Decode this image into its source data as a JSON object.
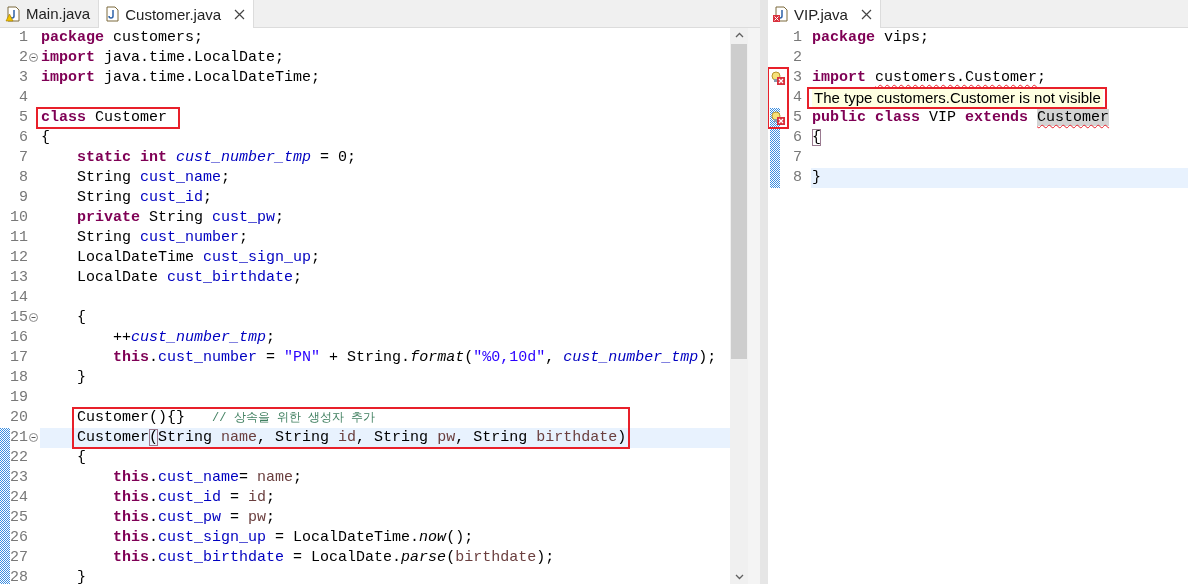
{
  "editors": [
    {
      "tabs": [
        {
          "label": "Main.java",
          "selected": false,
          "kind": "java_warning"
        },
        {
          "label": "Customer.java",
          "selected": true,
          "kind": "java"
        }
      ],
      "lines": [
        {
          "number": "1",
          "kind": "plain",
          "tokens": [
            {
              "kind": "keyword",
              "text": "package"
            },
            {
              "kind": "plain",
              "text": " customers;"
            }
          ]
        },
        {
          "number": "2",
          "kind": "plain",
          "foldable": true,
          "tokens": [
            {
              "kind": "keyword",
              "text": "import"
            },
            {
              "kind": "plain",
              "text": " java.time.LocalDate;"
            }
          ]
        },
        {
          "number": "3",
          "kind": "plain",
          "tokens": [
            {
              "kind": "keyword",
              "text": "import"
            },
            {
              "kind": "plain",
              "text": " java.time.LocalDateTime;"
            }
          ]
        },
        {
          "number": "4",
          "kind": "plain"
        },
        {
          "number": "5",
          "kind": "plain",
          "boxed": true,
          "tokens": [
            {
              "kind": "keyword",
              "text": "class"
            },
            {
              "kind": "plain",
              "text": " Customer "
            }
          ]
        },
        {
          "number": "6",
          "kind": "plain",
          "tokens": [
            {
              "kind": "plain",
              "text": "{"
            }
          ]
        },
        {
          "number": "7",
          "kind": "plain",
          "tokens": [
            {
              "kind": "keyword",
              "text": "    static "
            },
            {
              "kind": "keyword",
              "text": "int "
            },
            {
              "kind": "static_field",
              "text": "cust_number_tmp"
            },
            {
              "kind": "plain",
              "text": " = 0;"
            }
          ]
        },
        {
          "number": "8",
          "kind": "plain",
          "tokens": [
            {
              "kind": "plain",
              "text": "    String "
            },
            {
              "kind": "field",
              "text": "cust_name"
            },
            {
              "kind": "plain",
              "text": ";"
            }
          ]
        },
        {
          "number": "9",
          "kind": "plain",
          "tokens": [
            {
              "kind": "plain",
              "text": "    String "
            },
            {
              "kind": "field",
              "text": "cust_id"
            },
            {
              "kind": "plain",
              "text": ";"
            }
          ]
        },
        {
          "number": "10",
          "kind": "plain",
          "tokens": [
            {
              "kind": "keyword",
              "text": "    private"
            },
            {
              "kind": "plain",
              "text": " String "
            },
            {
              "kind": "field",
              "text": "cust_pw"
            },
            {
              "kind": "plain",
              "text": ";"
            }
          ]
        },
        {
          "number": "11",
          "kind": "plain",
          "tokens": [
            {
              "kind": "plain",
              "text": "    String "
            },
            {
              "kind": "field",
              "text": "cust_number"
            },
            {
              "kind": "plain",
              "text": ";"
            }
          ]
        },
        {
          "number": "12",
          "kind": "plain",
          "tokens": [
            {
              "kind": "plain",
              "text": "    LocalDateTime "
            },
            {
              "kind": "field",
              "text": "cust_sign_up"
            },
            {
              "kind": "plain",
              "text": ";"
            }
          ]
        },
        {
          "number": "13",
          "kind": "plain",
          "tokens": [
            {
              "kind": "plain",
              "text": "    LocalDate "
            },
            {
              "kind": "field",
              "text": "cust_birthdate"
            },
            {
              "kind": "plain",
              "text": ";"
            }
          ]
        },
        {
          "number": "14",
          "kind": "plain"
        },
        {
          "number": "15",
          "kind": "plain",
          "foldable": true,
          "tokens": [
            {
              "kind": "plain",
              "text": "    {"
            }
          ]
        },
        {
          "number": "16",
          "kind": "plain",
          "tokens": [
            {
              "kind": "plain",
              "text": "        ++"
            },
            {
              "kind": "static_field",
              "text": "cust_number_tmp"
            },
            {
              "kind": "plain",
              "text": ";"
            }
          ]
        },
        {
          "number": "17",
          "kind": "plain",
          "tokens": [
            {
              "kind": "keyword",
              "text": "        this"
            },
            {
              "kind": "plain",
              "text": "."
            },
            {
              "kind": "field",
              "text": "cust_number"
            },
            {
              "kind": "plain",
              "text": " = "
            },
            {
              "kind": "string",
              "text": "\"PN\""
            },
            {
              "kind": "plain",
              "text": " + String."
            },
            {
              "kind": "static_method",
              "text": "format"
            },
            {
              "kind": "plain",
              "text": "("
            },
            {
              "kind": "string",
              "text": "\"%0,10d\""
            },
            {
              "kind": "plain",
              "text": ", "
            },
            {
              "kind": "static_field",
              "text": "cust_number_tmp"
            },
            {
              "kind": "plain",
              "text": ");"
            }
          ]
        },
        {
          "number": "18",
          "kind": "plain",
          "tokens": [
            {
              "kind": "plain",
              "text": "    }"
            }
          ]
        },
        {
          "number": "19",
          "kind": "plain"
        },
        {
          "number": "20",
          "kind": "plain",
          "boxed": true,
          "tokens": [
            {
              "kind": "plain",
              "text": "    Customer(){}   "
            },
            {
              "kind": "comment",
              "text": "// 상속을 위한 생성자 추가"
            }
          ]
        },
        {
          "number": "21",
          "kind": "plain",
          "foldable": true,
          "changed": true,
          "highlighted": true,
          "boxed": true,
          "tokens": [
            {
              "kind": "plain",
              "text": "    Customer"
            },
            {
              "kind": "bracket_match",
              "text": "("
            },
            {
              "kind": "plain",
              "text": "String "
            },
            {
              "kind": "param",
              "text": "name"
            },
            {
              "kind": "plain",
              "text": ", String "
            },
            {
              "kind": "param",
              "text": "id"
            },
            {
              "kind": "plain",
              "text": ", String "
            },
            {
              "kind": "param",
              "text": "pw"
            },
            {
              "kind": "plain",
              "text": ", String "
            },
            {
              "kind": "param",
              "text": "birthdate"
            },
            {
              "kind": "plain",
              "text": ")"
            }
          ]
        },
        {
          "number": "22",
          "kind": "plain",
          "changed": true,
          "tokens": [
            {
              "kind": "plain",
              "text": "    {"
            }
          ]
        },
        {
          "number": "23",
          "kind": "plain",
          "changed": true,
          "tokens": [
            {
              "kind": "keyword",
              "text": "        this"
            },
            {
              "kind": "plain",
              "text": "."
            },
            {
              "kind": "field",
              "text": "cust_name"
            },
            {
              "kind": "plain",
              "text": "= "
            },
            {
              "kind": "param",
              "text": "name"
            },
            {
              "kind": "plain",
              "text": ";"
            }
          ]
        },
        {
          "number": "24",
          "kind": "plain",
          "changed": true,
          "tokens": [
            {
              "kind": "keyword",
              "text": "        this"
            },
            {
              "kind": "plain",
              "text": "."
            },
            {
              "kind": "field",
              "text": "cust_id"
            },
            {
              "kind": "plain",
              "text": " = "
            },
            {
              "kind": "param",
              "text": "id"
            },
            {
              "kind": "plain",
              "text": ";"
            }
          ]
        },
        {
          "number": "25",
          "kind": "plain",
          "changed": true,
          "tokens": [
            {
              "kind": "keyword",
              "text": "        this"
            },
            {
              "kind": "plain",
              "text": "."
            },
            {
              "kind": "field",
              "text": "cust_pw"
            },
            {
              "kind": "plain",
              "text": " = "
            },
            {
              "kind": "param",
              "text": "pw"
            },
            {
              "kind": "plain",
              "text": ";"
            }
          ]
        },
        {
          "number": "26",
          "kind": "plain",
          "changed": true,
          "tokens": [
            {
              "kind": "keyword",
              "text": "        this"
            },
            {
              "kind": "plain",
              "text": "."
            },
            {
              "kind": "field",
              "text": "cust_sign_up"
            },
            {
              "kind": "plain",
              "text": " = LocalDateTime."
            },
            {
              "kind": "static_method",
              "text": "now"
            },
            {
              "kind": "plain",
              "text": "();"
            }
          ]
        },
        {
          "number": "27",
          "kind": "plain",
          "changed": true,
          "tokens": [
            {
              "kind": "keyword",
              "text": "        this"
            },
            {
              "kind": "plain",
              "text": "."
            },
            {
              "kind": "field",
              "text": "cust_birthdate"
            },
            {
              "kind": "plain",
              "text": " = LocalDate."
            },
            {
              "kind": "static_method",
              "text": "parse"
            },
            {
              "kind": "plain",
              "text": "("
            },
            {
              "kind": "param",
              "text": "birthdate"
            },
            {
              "kind": "plain",
              "text": ");"
            }
          ]
        },
        {
          "number": "28",
          "kind": "plain",
          "changed": true,
          "tokens": [
            {
              "kind": "plain",
              "text": "    }"
            }
          ]
        }
      ]
    },
    {
      "tabs": [
        {
          "label": "VIP.java",
          "selected": true,
          "kind": "java_error"
        }
      ],
      "lines": [
        {
          "number": "1",
          "kind": "plain",
          "tokens": [
            {
              "kind": "keyword",
              "text": "package"
            },
            {
              "kind": "plain",
              "text": " vips;"
            }
          ]
        },
        {
          "number": "2",
          "kind": "plain"
        },
        {
          "number": "3",
          "kind": "error",
          "marker_boxed": true,
          "tokens": [
            {
              "kind": "keyword",
              "text": "import "
            },
            {
              "kind": "error_plain",
              "text": "customers.Customer"
            },
            {
              "kind": "plain",
              "text": ";"
            }
          ]
        },
        {
          "number": "4",
          "kind": "plain",
          "marker_boxed": true,
          "boxed": true,
          "tokens": [
            {
              "kind": "tooltip",
              "text": "The type customers.Customer is not visible"
            }
          ]
        },
        {
          "number": "5",
          "kind": "error",
          "marker_boxed": true,
          "changed": true,
          "tokens": [
            {
              "kind": "keyword",
              "text": "public "
            },
            {
              "kind": "keyword",
              "text": "class"
            },
            {
              "kind": "plain",
              "text": " VIP "
            },
            {
              "kind": "keyword",
              "text": "extends "
            },
            {
              "kind": "error_ref",
              "text": "Customer"
            }
          ]
        },
        {
          "number": "6",
          "kind": "plain",
          "changed": true,
          "tokens": [
            {
              "kind": "bracket_match",
              "text": "{"
            }
          ]
        },
        {
          "number": "7",
          "kind": "plain",
          "changed": true
        },
        {
          "number": "8",
          "kind": "plain",
          "changed": true,
          "highlighted": true,
          "tokens": [
            {
              "kind": "plain",
              "text": "}"
            }
          ]
        }
      ]
    }
  ]
}
